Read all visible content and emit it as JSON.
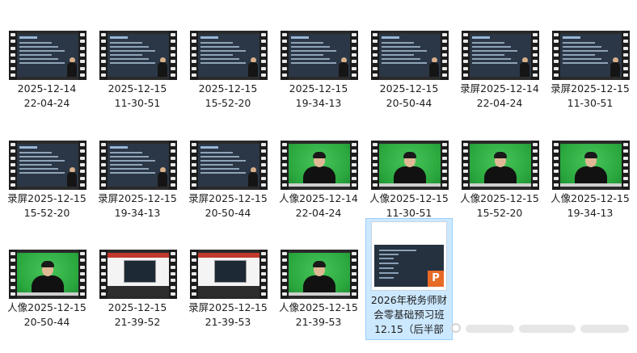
{
  "files": [
    {
      "kind": "slide",
      "line1": "2025-12-14",
      "line2": "22-04-24"
    },
    {
      "kind": "slide",
      "line1": "2025-12-15",
      "line2": "11-30-51"
    },
    {
      "kind": "slide",
      "line1": "2025-12-15",
      "line2": "15-52-20"
    },
    {
      "kind": "slide",
      "line1": "2025-12-15",
      "line2": "19-34-13"
    },
    {
      "kind": "slide",
      "line1": "2025-12-15",
      "line2": "20-50-44"
    },
    {
      "kind": "slide",
      "line1": "录屏2025-12-14",
      "line2": "22-04-24"
    },
    {
      "kind": "slide",
      "line1": "录屏2025-12-15",
      "line2": "11-30-51"
    },
    {
      "kind": "slide",
      "line1": "录屏2025-12-15",
      "line2": "15-52-20"
    },
    {
      "kind": "slide",
      "line1": "录屏2025-12-15",
      "line2": "19-34-13"
    },
    {
      "kind": "slide",
      "line1": "录屏2025-12-15",
      "line2": "20-50-44"
    },
    {
      "kind": "green",
      "line1": "人像2025-12-14",
      "line2": "22-04-24"
    },
    {
      "kind": "green",
      "line1": "人像2025-12-15",
      "line2": "11-30-51"
    },
    {
      "kind": "green",
      "line1": "人像2025-12-15",
      "line2": "15-52-20"
    },
    {
      "kind": "green",
      "line1": "人像2025-12-15",
      "line2": "19-34-13"
    },
    {
      "kind": "green",
      "line1": "人像2025-12-15",
      "line2": "20-50-44"
    },
    {
      "kind": "screen",
      "line1": "2025-12-15",
      "line2": "21-39-52"
    },
    {
      "kind": "screen",
      "line1": "录屏2025-12-15",
      "line2": "21-39-53"
    },
    {
      "kind": "green",
      "line1": "人像2025-12-15",
      "line2": "21-39-53"
    }
  ],
  "ppt_file": {
    "name_lines": [
      "2026年税务师财",
      "会零基础预习班",
      "12.15（后半部"
    ],
    "badge": "P",
    "badge_color": "#e86a27",
    "selected": true
  }
}
